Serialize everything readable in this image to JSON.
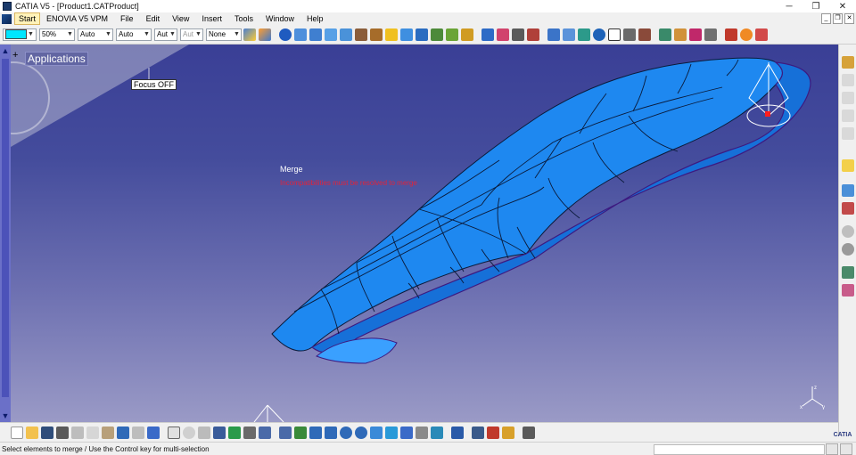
{
  "window": {
    "title": "CATIA V5 - [Product1.CATProduct]",
    "controls": {
      "minimize": "─",
      "maximize": "❐",
      "close": "✕"
    }
  },
  "menu": {
    "items": [
      "Start",
      "ENOVIA V5 VPM",
      "File",
      "Edit",
      "View",
      "Insert",
      "Tools",
      "Window",
      "Help"
    ]
  },
  "toolbar": {
    "fill_color": "#00e6ff",
    "transparency": "50%",
    "line_thickness": "Auto",
    "line_type": "Auto",
    "point_symbol": "Aut",
    "layer": "Aut",
    "rendering": "None"
  },
  "viewport": {
    "tree_root": "Applications",
    "focus_label": "Focus OFF",
    "command_title": "Merge",
    "command_message": "Incompatibilities must be resolved to merge"
  },
  "axes": {
    "x": "x",
    "y": "y",
    "z": "z"
  },
  "status": {
    "text": "Select elements to merge / Use the Control key for multi-selection"
  },
  "colors": {
    "surface": "#1e88f0",
    "background_top": "#3a3f96",
    "background_bottom": "#9a9ac6",
    "highlight": "#e0243c"
  }
}
